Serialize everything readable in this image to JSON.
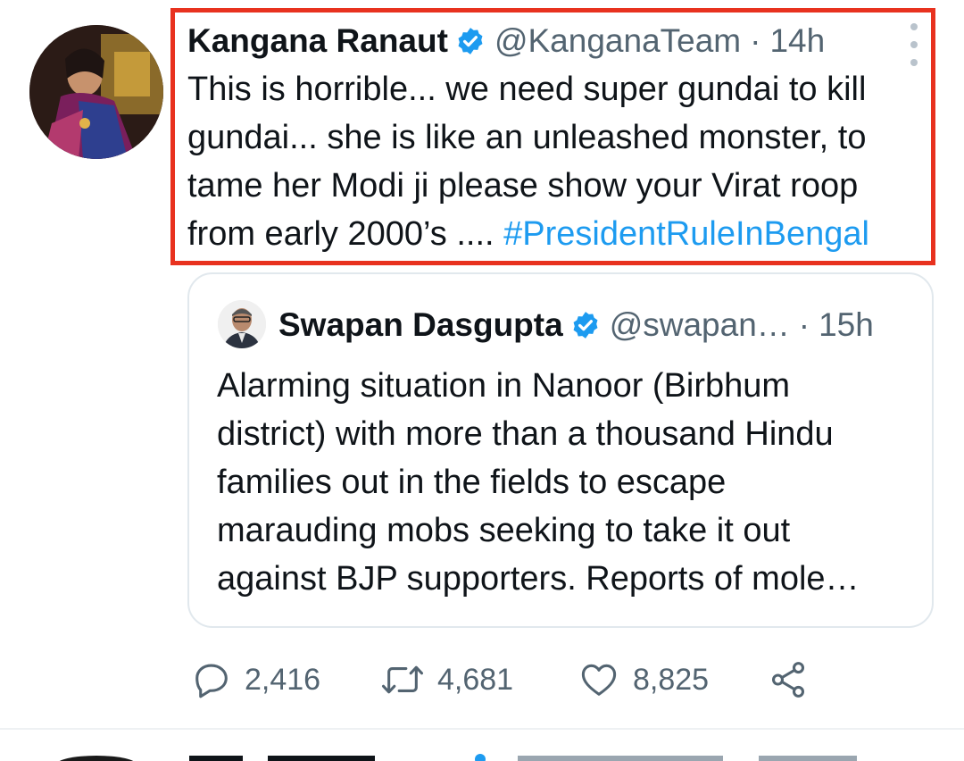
{
  "tweet": {
    "author_name": "Kangana Ranaut",
    "handle": "@KanganaTeam",
    "separator": "·",
    "time": "14h",
    "verified_icon": "verified-badge-icon",
    "more_icon": "more-vertical-icon",
    "text_lines": [
      "This is horrible... we need super gundai to kill",
      "gundai... she is like an unleashed monster, to",
      "tame her Modi ji please show your Virat roop",
      "from early 2000’s .... "
    ],
    "hashtag": "#PresidentRuleInBengal"
  },
  "quoted_tweet": {
    "author_name": "Swapan Dasgupta",
    "handle": "@swapan…",
    "separator": "·",
    "time": "15h",
    "text_lines": [
      "Alarming situation in Nanoor (Birbhum",
      "district) with more than a thousand Hindu",
      "families out in the fields to escape",
      "marauding mobs seeking to take it out",
      "against BJP supporters. Reports of mole…"
    ]
  },
  "actions": {
    "reply": {
      "icon": "reply-icon",
      "count": "2,416"
    },
    "retweet": {
      "icon": "retweet-icon",
      "count": "4,681"
    },
    "like": {
      "icon": "heart-icon",
      "count": "8,825"
    },
    "share": {
      "icon": "share-icon"
    }
  },
  "colors": {
    "highlight_border": "#e8321f",
    "link": "#1d9bf0",
    "verified": "#1d9bf0",
    "muted": "#536471"
  }
}
